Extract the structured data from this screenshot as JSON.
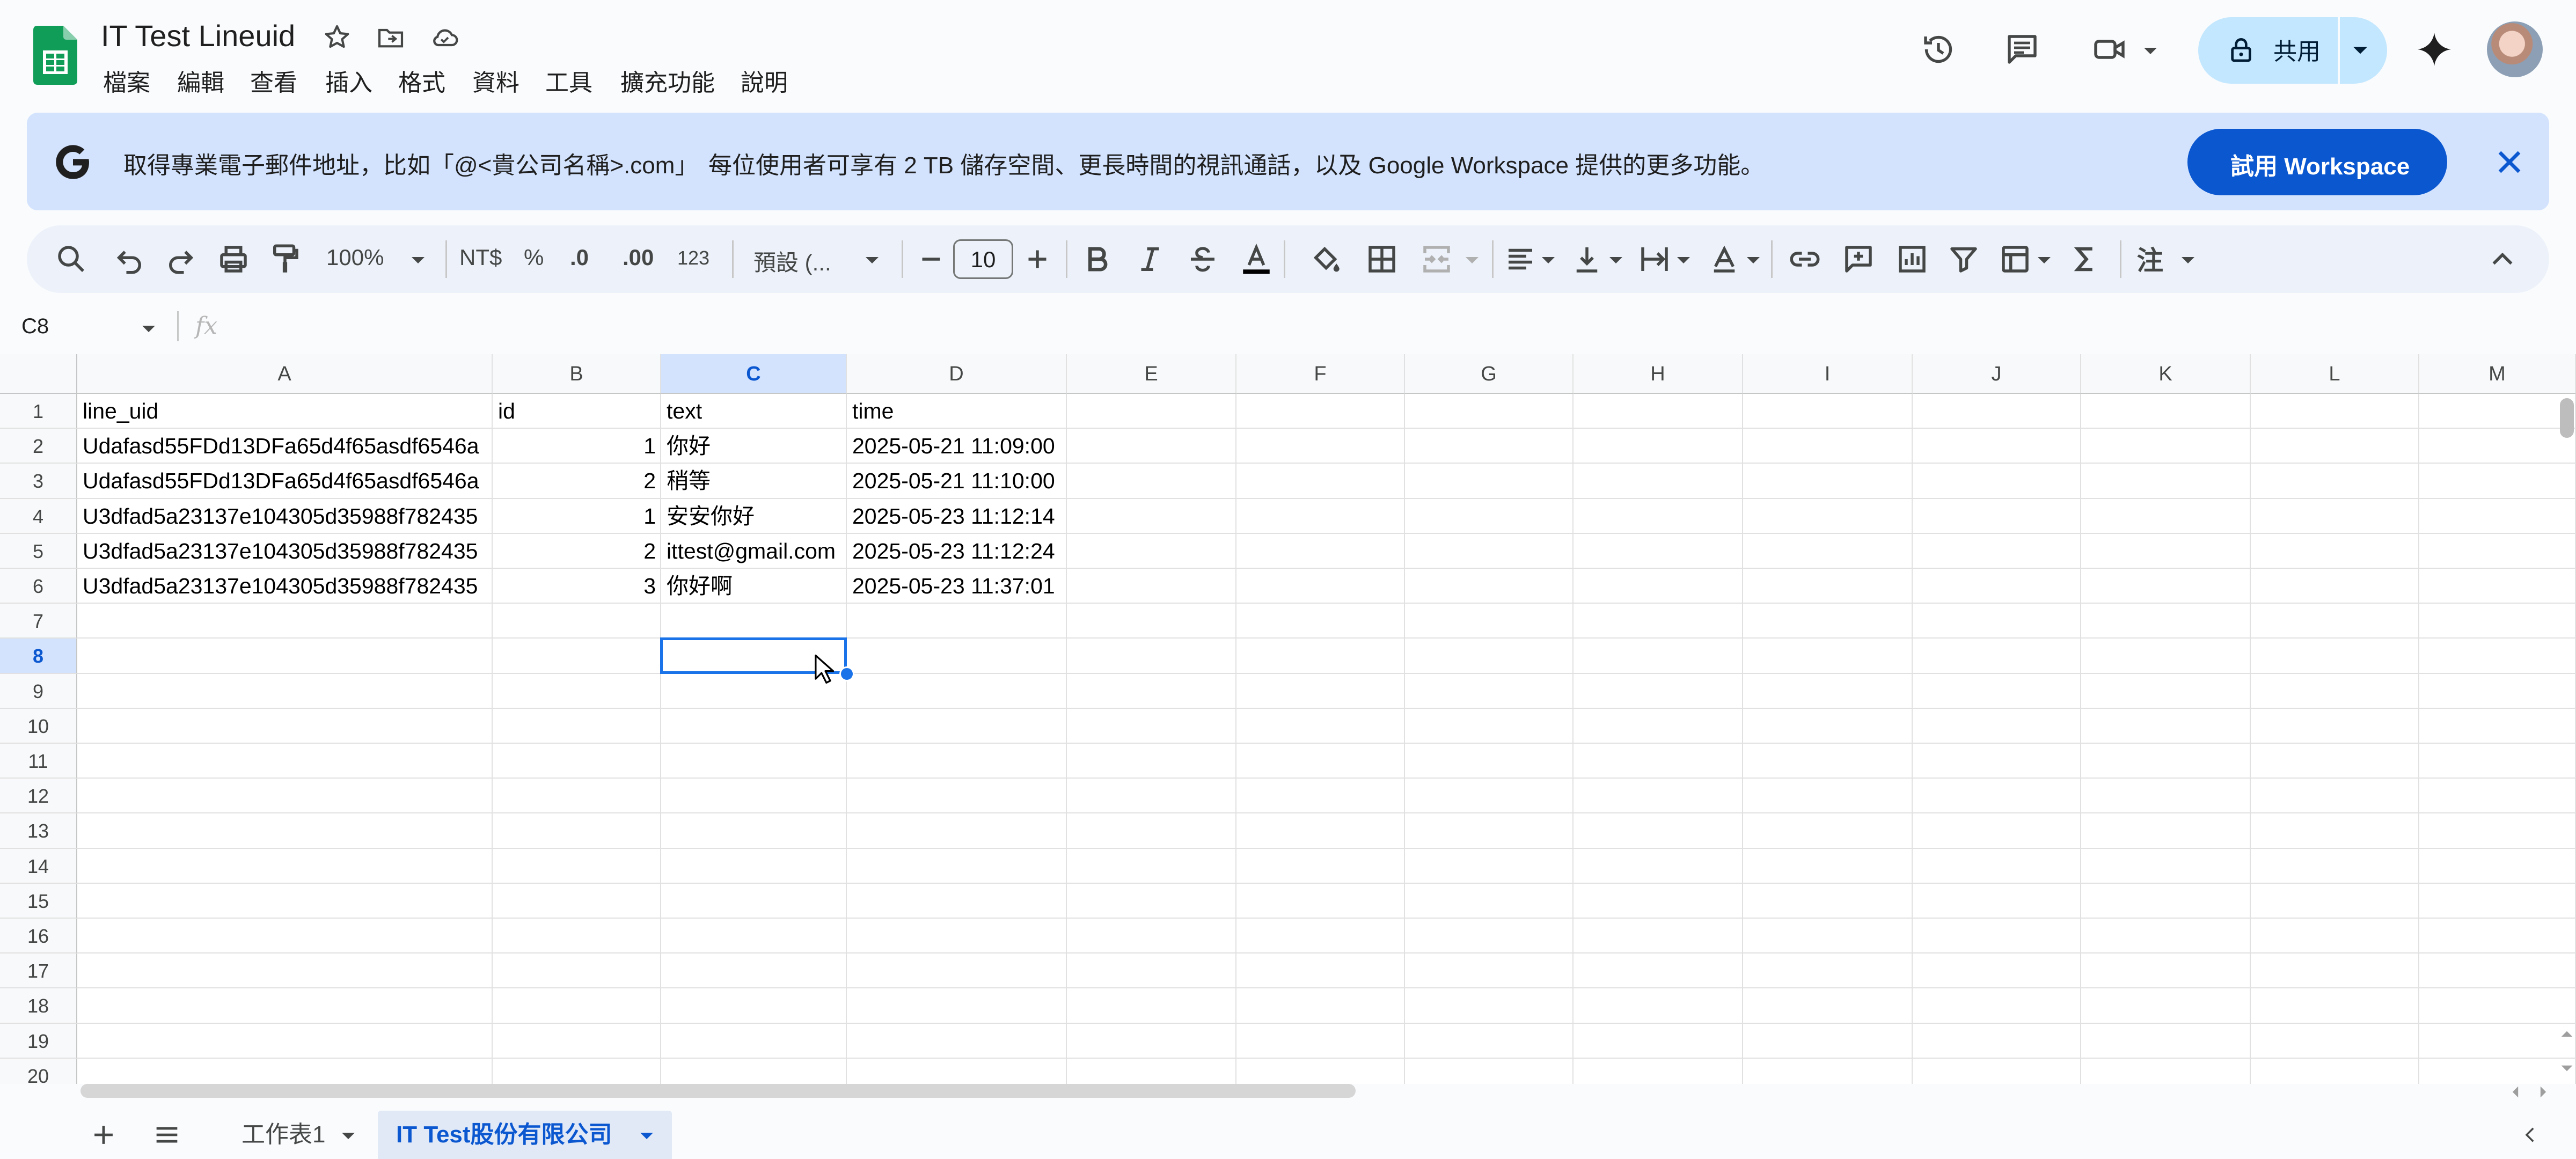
{
  "app": {
    "title": "IT Test Lineuid",
    "menu": [
      "檔案",
      "編輯",
      "查看",
      "插入",
      "格式",
      "資料",
      "工具",
      "擴充功能",
      "說明"
    ],
    "share_label": "共用"
  },
  "banner": {
    "bold_text": "取得專業電子郵件地址，比如「@<貴公司名稱>.com」",
    "rest_text": "每位使用者可享有 2 TB 儲存空間、更長時間的視訊通話，以及 Google Workspace 提供的更多功能。",
    "button_label": "試用 Workspace"
  },
  "toolbar": {
    "zoom": "100%",
    "currency": "NT$",
    "percent": "%",
    "decrease_decimal": ".0",
    "increase_decimal": ".00",
    "number_format": "123",
    "font": "預設 (...",
    "font_size": "10"
  },
  "formula_bar": {
    "name_box": "C8",
    "fx": "fx"
  },
  "grid": {
    "columns": [
      "A",
      "B",
      "C",
      "D",
      "E",
      "F",
      "G",
      "H",
      "I",
      "J",
      "K",
      "L",
      "M"
    ],
    "rows": [
      "1",
      "2",
      "3",
      "4",
      "5",
      "6",
      "7",
      "8",
      "9",
      "10",
      "11",
      "12",
      "13",
      "14",
      "15",
      "16",
      "17",
      "18",
      "19",
      "20"
    ],
    "selected_column": "C",
    "selected_row": "8",
    "cells": [
      [
        "line_uid",
        "id",
        "text",
        "time"
      ],
      [
        "Udafasd55FDd13DFa65d4f65asdf6546a",
        "1",
        "你好",
        "2025-05-21 11:09:00"
      ],
      [
        "Udafasd55FDd13DFa65d4f65asdf6546a",
        "2",
        "稍等",
        "2025-05-21 11:10:00"
      ],
      [
        "U3dfad5a23137e104305d35988f782435",
        "1",
        "安安你好",
        "2025-05-23 11:12:14"
      ],
      [
        "U3dfad5a23137e104305d35988f782435",
        "2",
        "ittest@gmail.com",
        "2025-05-23 11:12:24"
      ],
      [
        "U3dfad5a23137e104305d35988f782435",
        "3",
        "你好啊",
        "2025-05-23 11:37:01"
      ]
    ]
  },
  "sheets": {
    "tabs": [
      "工作表1",
      "IT Test股份有限公司"
    ],
    "active": "IT Test股份有限公司"
  },
  "colors": {
    "accent": "#0b57d0",
    "selection": "#1a73e8",
    "share_bg": "#c2e7ff",
    "banner_bg": "#d3e3fd",
    "sheets_green": "#0f9d58"
  }
}
